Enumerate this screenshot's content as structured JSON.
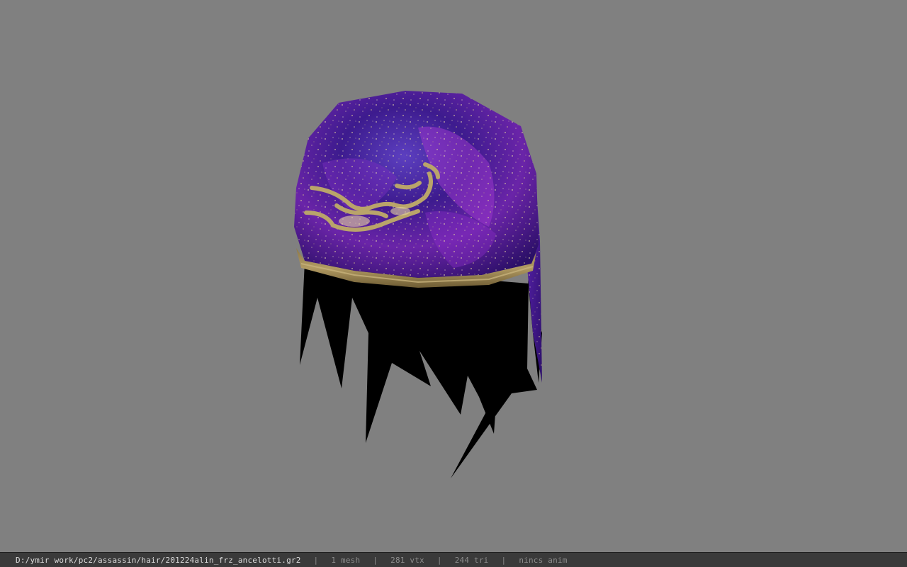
{
  "viewer": {
    "background_color": "#808080",
    "model_description": "model-preview",
    "model_colors": {
      "cap_primary": "#4a1f9a",
      "cap_highlight": "#a035d0",
      "trim_gold": "#a48a52",
      "hair": "#000000"
    }
  },
  "status_bar": {
    "file_path": "D:/ymir work/pc2/assassin/hair/201224alin_frz_ancelotti.gr2",
    "separator": "|",
    "mesh_count": "1 mesh",
    "vertex_count": "281 vtx",
    "triangle_count": "244 tri",
    "animation": "nincs anim"
  }
}
